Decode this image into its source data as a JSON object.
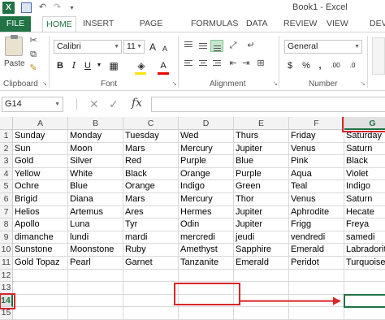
{
  "app": {
    "logo": "X",
    "title": "Book1 - Excel",
    "qat_save": "💾",
    "qat_undo": "↶",
    "qat_redo": "↷"
  },
  "tabs": [
    "FILE",
    "HOME",
    "INSERT",
    "PAGE LAYOUT",
    "FORMULAS",
    "DATA",
    "REVIEW",
    "VIEW",
    "DEVEL"
  ],
  "ribbon": {
    "clipboard": {
      "label": "Clipboard",
      "paste": "Paste"
    },
    "font": {
      "label": "Font",
      "name": "Calibri",
      "size": "11",
      "bold": "B",
      "italic": "I",
      "underline": "U",
      "grow": "A",
      "shrink": "A"
    },
    "alignment": {
      "label": "Alignment"
    },
    "number": {
      "label": "Number",
      "format": "General",
      "currency": "$",
      "percent": "%",
      "comma": ",",
      "inc": ".00",
      "dec": ".0"
    }
  },
  "formula_bar": {
    "namebox": "G14",
    "cancel": "✕",
    "enter": "✓",
    "fx": "fx",
    "value": ""
  },
  "sheet": {
    "columns": [
      "A",
      "B",
      "C",
      "D",
      "E",
      "F",
      "G"
    ],
    "rows": [
      "1",
      "2",
      "3",
      "4",
      "5",
      "6",
      "7",
      "8",
      "9",
      "10",
      "11",
      "12",
      "13",
      "14",
      "15"
    ],
    "selected_cell": "G14",
    "cells": [
      [
        "Sunday",
        "Monday",
        "Tuesday",
        "Wed",
        "Thurs",
        "Friday",
        "Saturday"
      ],
      [
        "Sun",
        "Moon",
        "Mars",
        "Mercury",
        "Jupiter",
        "Venus",
        "Saturn"
      ],
      [
        "Gold",
        "Silver",
        "Red",
        "Purple",
        "Blue",
        "Pink",
        "Black"
      ],
      [
        "Yellow",
        "White",
        "Black",
        "Orange",
        "Purple",
        "Aqua",
        "Violet"
      ],
      [
        "Ochre",
        "Blue",
        "Orange",
        "Indigo",
        "Green",
        "Teal",
        "Indigo"
      ],
      [
        "Brigid",
        "Diana",
        "Mars",
        "Mercury",
        "Thor",
        "Venus",
        "Saturn"
      ],
      [
        "Helios",
        "Artemus",
        "Ares",
        "Hermes",
        "Jupiter",
        "Aphrodite",
        "Hecate"
      ],
      [
        "Apollo",
        "Luna",
        "Tyr",
        "Odin",
        "Jupiter",
        "Frigg",
        "Freya"
      ],
      [
        "dimanche",
        "lundi",
        "mardi",
        "mercredi",
        "jeudi",
        "vendredi",
        "samedi"
      ],
      [
        "Sunstone",
        "Moonstone",
        "Ruby",
        "Amethyst",
        "Sapphire",
        "Emerald",
        "Labradorite"
      ],
      [
        "Gold Topaz",
        "Pearl",
        "Garnet",
        "Tanzanite",
        "Emerald",
        "Peridot",
        "Turquoise"
      ],
      [
        "",
        "",
        "",
        "",
        "",
        "",
        ""
      ],
      [
        "",
        "",
        "",
        "",
        "",
        "",
        ""
      ],
      [
        "",
        "",
        "",
        "",
        "",
        "",
        ""
      ],
      [
        "",
        "",
        "",
        "",
        "",
        "",
        ""
      ]
    ]
  },
  "colors": {
    "accent": "#217346",
    "annotation": "#d9262b"
  }
}
